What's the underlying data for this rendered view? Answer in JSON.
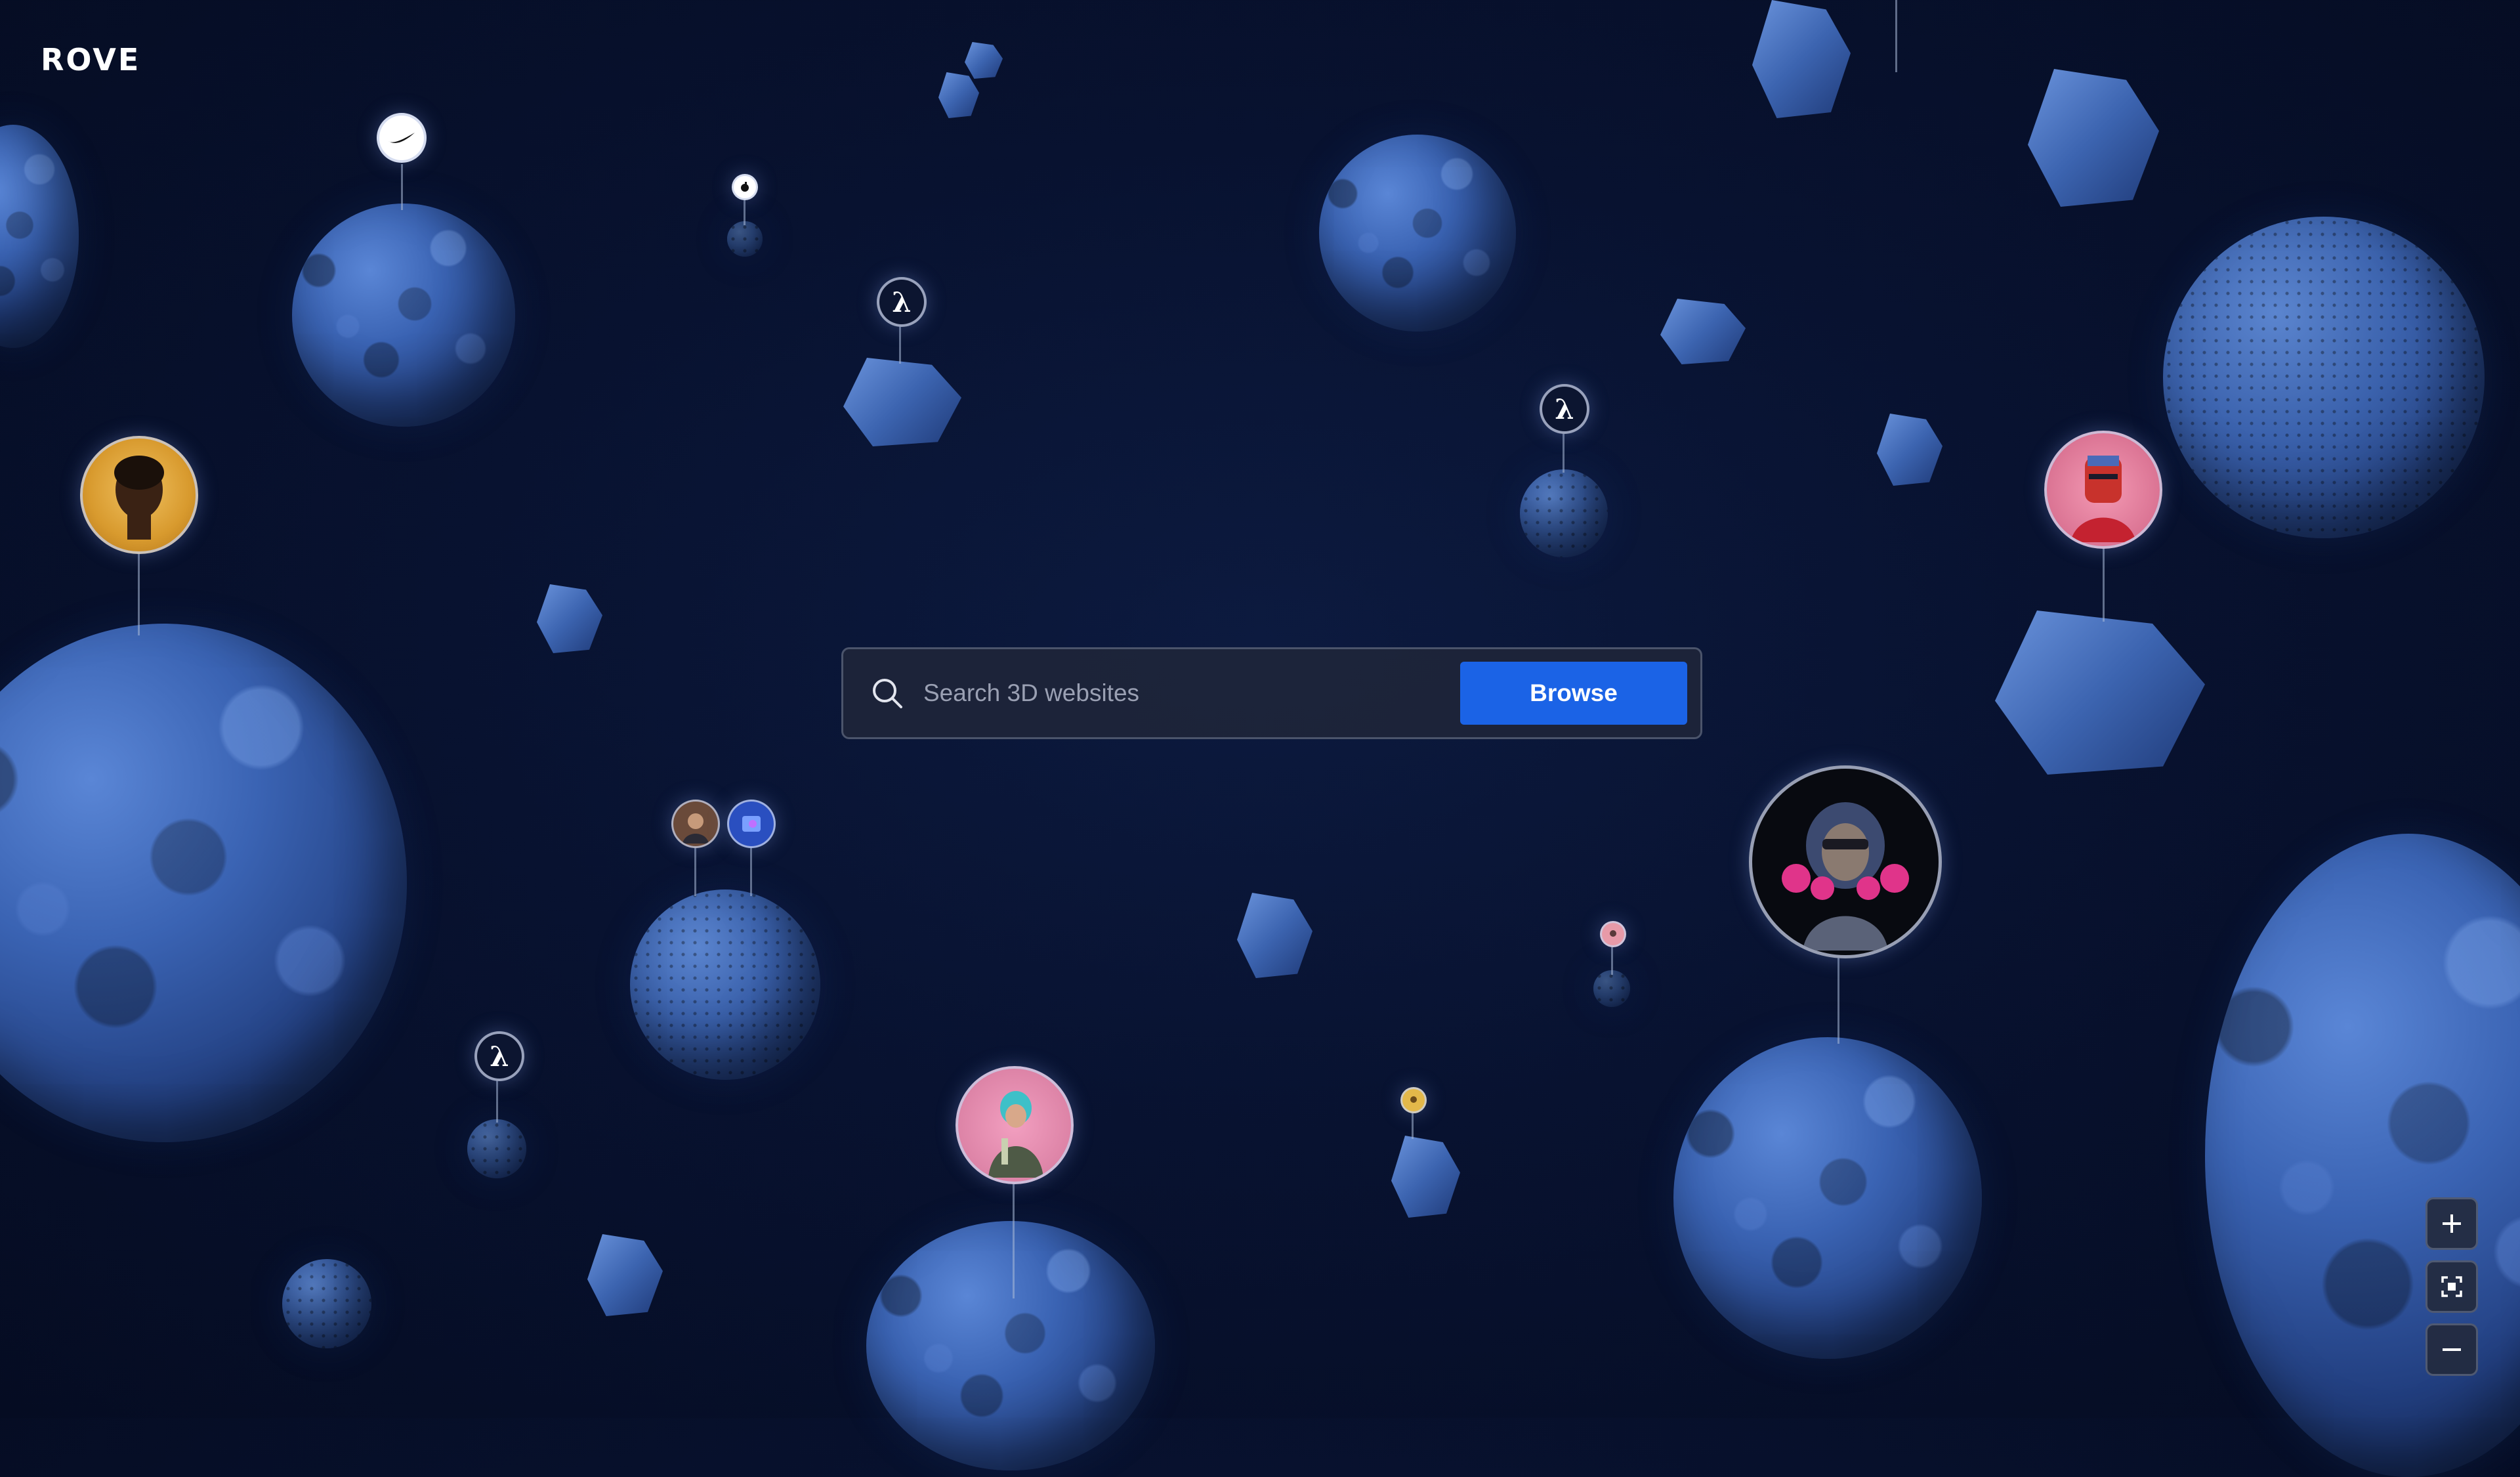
{
  "app": {
    "logo": "ROVE"
  },
  "search": {
    "placeholder": "Search 3D websites",
    "value": ""
  },
  "actions": {
    "browse_label": "Browse"
  },
  "pins": {
    "lambda_symbol": "λ"
  },
  "zoom_controls": {
    "zoom_in_icon": "plus-icon",
    "recenter_icon": "focus-icon",
    "zoom_out_icon": "minus-icon"
  },
  "colors": {
    "background": "#081230",
    "accent": "#1b63e6",
    "cluster_blue": "#3a63b3"
  }
}
